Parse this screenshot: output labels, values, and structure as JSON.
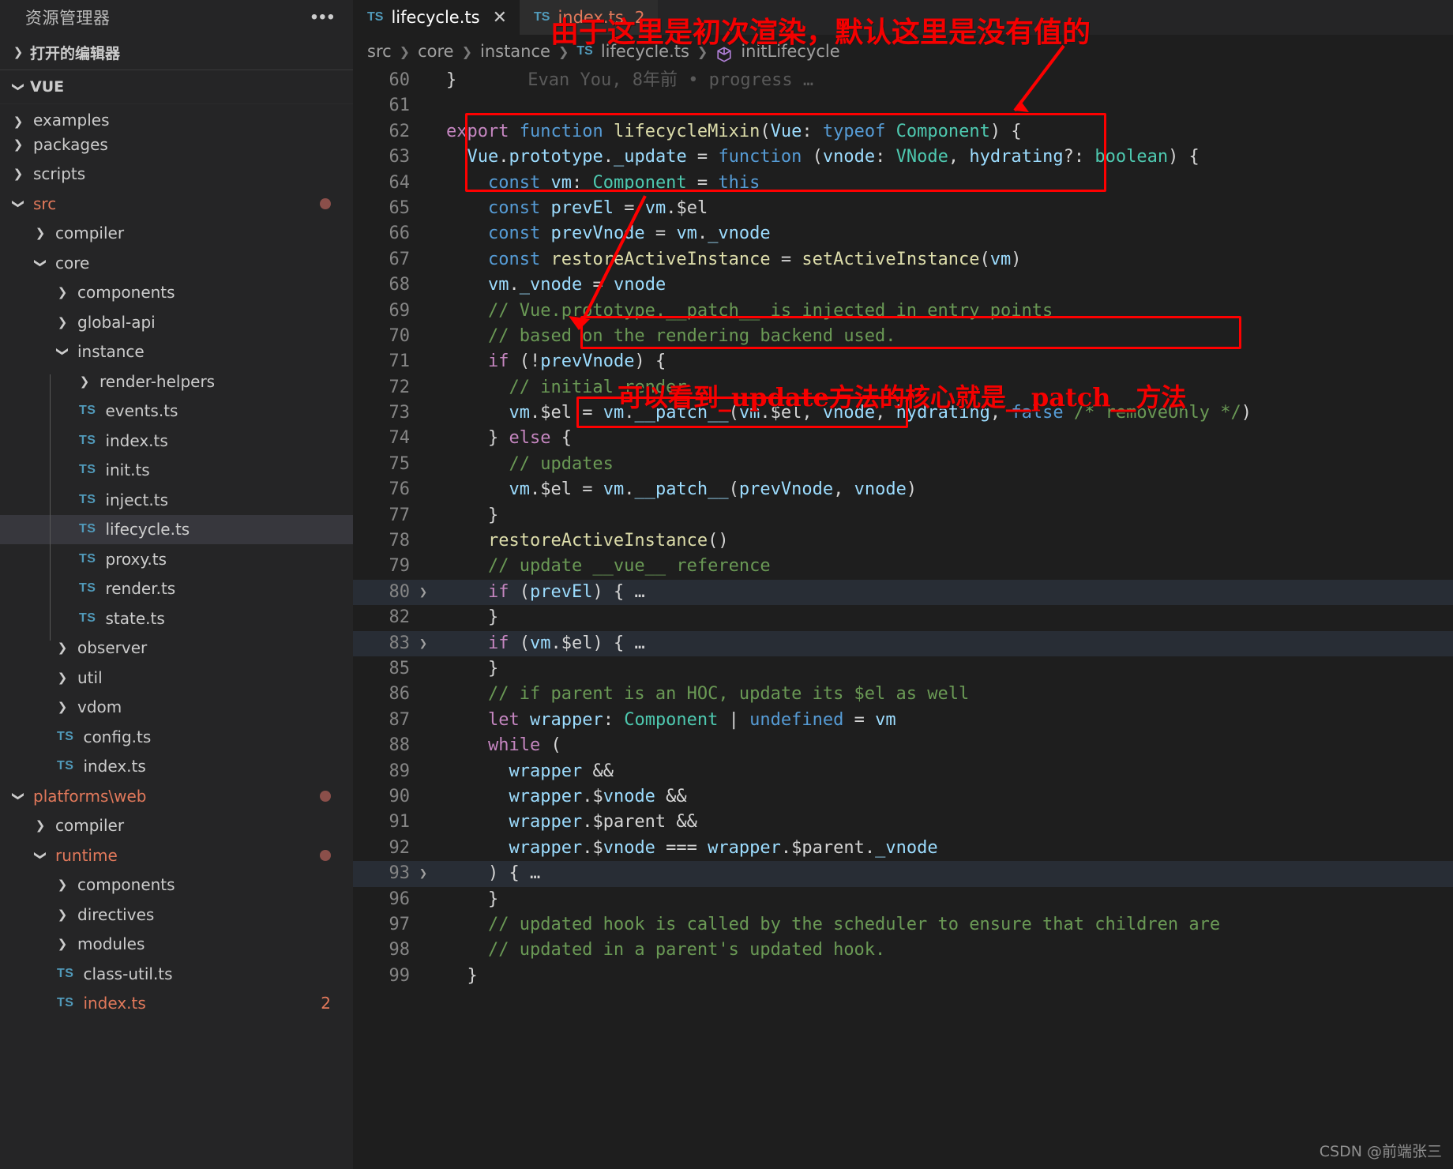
{
  "sidebar": {
    "title": "资源管理器",
    "more_icon": "ellipsis-icon",
    "open_editors_label": "打开的编辑器",
    "workspace_label": "VUE",
    "items": [
      {
        "label": "examples",
        "indent": 1,
        "kind": "folder",
        "state": "collapsed",
        "cut": true
      },
      {
        "label": "packages",
        "indent": 1,
        "kind": "folder",
        "state": "collapsed"
      },
      {
        "label": "scripts",
        "indent": 1,
        "kind": "folder",
        "state": "collapsed"
      },
      {
        "label": "src",
        "indent": 1,
        "kind": "folder",
        "state": "expanded",
        "modified": true,
        "dot": true
      },
      {
        "label": "compiler",
        "indent": 2,
        "kind": "folder",
        "state": "collapsed"
      },
      {
        "label": "core",
        "indent": 2,
        "kind": "folder",
        "state": "expanded"
      },
      {
        "label": "components",
        "indent": 3,
        "kind": "folder",
        "state": "collapsed"
      },
      {
        "label": "global-api",
        "indent": 3,
        "kind": "folder",
        "state": "collapsed"
      },
      {
        "label": "instance",
        "indent": 3,
        "kind": "folder",
        "state": "expanded"
      },
      {
        "label": "render-helpers",
        "indent": 4,
        "kind": "folder",
        "state": "collapsed"
      },
      {
        "label": "events.ts",
        "indent": 4,
        "kind": "ts"
      },
      {
        "label": "index.ts",
        "indent": 4,
        "kind": "ts"
      },
      {
        "label": "init.ts",
        "indent": 4,
        "kind": "ts"
      },
      {
        "label": "inject.ts",
        "indent": 4,
        "kind": "ts"
      },
      {
        "label": "lifecycle.ts",
        "indent": 4,
        "kind": "ts",
        "selected": true
      },
      {
        "label": "proxy.ts",
        "indent": 4,
        "kind": "ts"
      },
      {
        "label": "render.ts",
        "indent": 4,
        "kind": "ts"
      },
      {
        "label": "state.ts",
        "indent": 4,
        "kind": "ts"
      },
      {
        "label": "observer",
        "indent": 3,
        "kind": "folder",
        "state": "collapsed"
      },
      {
        "label": "util",
        "indent": 3,
        "kind": "folder",
        "state": "collapsed"
      },
      {
        "label": "vdom",
        "indent": 3,
        "kind": "folder",
        "state": "collapsed"
      },
      {
        "label": "config.ts",
        "indent": 3,
        "kind": "ts"
      },
      {
        "label": "index.ts",
        "indent": 3,
        "kind": "ts"
      },
      {
        "label": "platforms\\web",
        "indent": 1,
        "kind": "folder",
        "state": "expanded",
        "modified": true,
        "dot": true
      },
      {
        "label": "compiler",
        "indent": 2,
        "kind": "folder",
        "state": "collapsed"
      },
      {
        "label": "runtime",
        "indent": 2,
        "kind": "folder",
        "state": "expanded",
        "modified": true,
        "dot": true
      },
      {
        "label": "components",
        "indent": 3,
        "kind": "folder",
        "state": "collapsed"
      },
      {
        "label": "directives",
        "indent": 3,
        "kind": "folder",
        "state": "collapsed"
      },
      {
        "label": "modules",
        "indent": 3,
        "kind": "folder",
        "state": "collapsed"
      },
      {
        "label": "class-util.ts",
        "indent": 3,
        "kind": "ts"
      },
      {
        "label": "index.ts",
        "indent": 3,
        "kind": "ts",
        "modified": true,
        "count": "2"
      }
    ]
  },
  "tabs": [
    {
      "icon": "ts-file-icon",
      "label": "lifecycle.ts",
      "active": true,
      "close_icon": "close-icon"
    },
    {
      "icon": "ts-file-icon",
      "label": "index.ts",
      "active": false,
      "modified": true,
      "badge": "2"
    }
  ],
  "breadcrumb": {
    "items": [
      "src",
      "core",
      "instance",
      "lifecycle.ts",
      "initLifecycle"
    ],
    "file_icon": "ts-file-icon",
    "symbol_icon": "cube-symbol-icon"
  },
  "editor": {
    "blame": "Evan You, 8年前 • progress …",
    "lines": [
      {
        "n": "60"
      },
      {
        "n": "61"
      },
      {
        "n": "62"
      },
      {
        "n": "63"
      },
      {
        "n": "64"
      },
      {
        "n": "65"
      },
      {
        "n": "66"
      },
      {
        "n": "67"
      },
      {
        "n": "68"
      },
      {
        "n": "69"
      },
      {
        "n": "70"
      },
      {
        "n": "71"
      },
      {
        "n": "72"
      },
      {
        "n": "73"
      },
      {
        "n": "74"
      },
      {
        "n": "75"
      },
      {
        "n": "76"
      },
      {
        "n": "77"
      },
      {
        "n": "78"
      },
      {
        "n": "79"
      },
      {
        "n": "80",
        "fold": true,
        "highlight": true
      },
      {
        "n": "82"
      },
      {
        "n": "83",
        "fold": true,
        "highlight": true
      },
      {
        "n": "85"
      },
      {
        "n": "86"
      },
      {
        "n": "87"
      },
      {
        "n": "88"
      },
      {
        "n": "89"
      },
      {
        "n": "90"
      },
      {
        "n": "91"
      },
      {
        "n": "92"
      },
      {
        "n": "93",
        "fold": true,
        "highlight": true
      },
      {
        "n": "96"
      },
      {
        "n": "97"
      },
      {
        "n": "98"
      },
      {
        "n": "99"
      }
    ],
    "source": [
      "}",
      "",
      "export function lifecycleMixin(Vue: typeof Component) {",
      "  Vue.prototype._update = function (vnode: VNode, hydrating?: boolean) {",
      "    const vm: Component = this",
      "    const prevEl = vm.$el",
      "    const prevVnode = vm._vnode",
      "    const restoreActiveInstance = setActiveInstance(vm)",
      "    vm._vnode = vnode",
      "    // Vue.prototype.__patch__ is injected in entry points",
      "    // based on the rendering backend used.",
      "    if (!prevVnode) {",
      "      // initial render",
      "      vm.$el = vm.__patch__(vm.$el, vnode, hydrating, false /* removeOnly */)",
      "    } else {",
      "      // updates",
      "      vm.$el = vm.__patch__(prevVnode, vnode)",
      "    }",
      "    restoreActiveInstance()",
      "    // update __vue__ reference",
      "    if (prevEl) { …",
      "    }",
      "    if (vm.$el) { …",
      "    }",
      "    // if parent is an HOC, update its $el as well",
      "    let wrapper: Component | undefined = vm",
      "    while (",
      "      wrapper &&",
      "      wrapper.$vnode &&",
      "      wrapper.$parent &&",
      "      wrapper.$vnode === wrapper.$parent._vnode",
      "    ) { …",
      "    }",
      "    // updated hook is called by the scheduler to ensure that children are",
      "    // updated in a parent's updated hook.",
      "  }"
    ]
  },
  "annotations": [
    {
      "id": "ann1",
      "text": "由于这里是初次渲染，默认这里是没有值的",
      "color": "#f50000"
    },
    {
      "id": "ann2",
      "text": "可以看到_update方法的核心就是__patch__方法",
      "color": "#f50000"
    }
  ],
  "watermark": "CSDN @前端张三",
  "colors": {
    "accent_red": "#fe0000",
    "modified": "#e2795b",
    "ts_blue": "#519aba",
    "editor_bg": "#1e1e1e",
    "sidebar_bg": "#252526"
  }
}
